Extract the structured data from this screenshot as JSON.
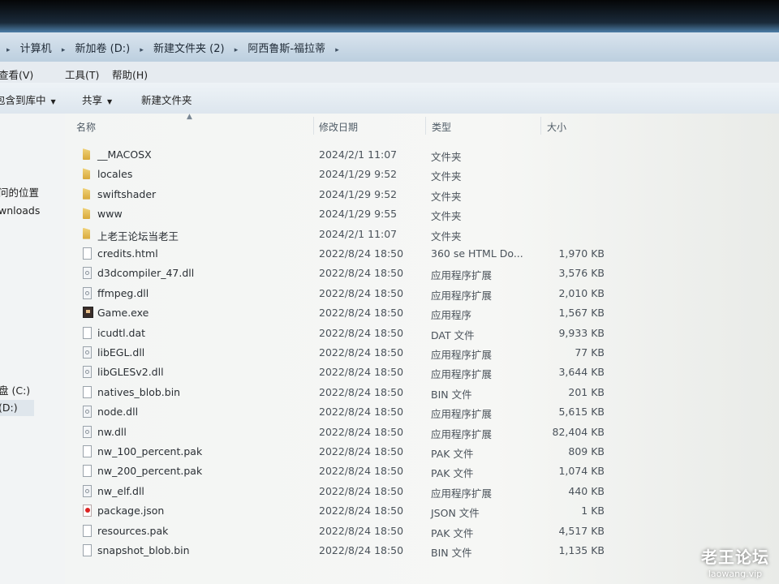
{
  "address": {
    "crumbs": [
      "计算机",
      "新加卷 (D:)",
      "新建文件夹 (2)",
      "阿西鲁斯-福拉蒂"
    ]
  },
  "menubar": {
    "view": "查看(V)",
    "tools": "工具(T)",
    "help": "帮助(H)"
  },
  "toolbar": {
    "include_library": "包含到库中",
    "share": "共享",
    "new_folder": "新建文件夹"
  },
  "nav": {
    "recent_places": "问的位置",
    "downloads": "wnloads",
    "drive_c": "盘 (C:)",
    "drive_d": "(D:)"
  },
  "columns": {
    "name": "名称",
    "date_modified": "修改日期",
    "type": "类型",
    "size": "大小"
  },
  "files": [
    {
      "icon": "folder-icon",
      "name": "__MACOSX",
      "date": "2024/2/1 11:07",
      "type": "文件夹",
      "size": ""
    },
    {
      "icon": "folder-icon",
      "name": "locales",
      "date": "2024/1/29 9:52",
      "type": "文件夹",
      "size": ""
    },
    {
      "icon": "folder-icon",
      "name": "swiftshader",
      "date": "2024/1/29 9:52",
      "type": "文件夹",
      "size": ""
    },
    {
      "icon": "folder-icon",
      "name": "www",
      "date": "2024/1/29 9:55",
      "type": "文件夹",
      "size": ""
    },
    {
      "icon": "folder-icon",
      "name": "上老王论坛当老王",
      "date": "2024/2/1 11:07",
      "type": "文件夹",
      "size": ""
    },
    {
      "icon": "html-file-icon",
      "name": "credits.html",
      "date": "2022/8/24 18:50",
      "type": "360 se HTML Do...",
      "size": "1,970 KB"
    },
    {
      "icon": "dll-file-icon",
      "name": "d3dcompiler_47.dll",
      "date": "2022/8/24 18:50",
      "type": "应用程序扩展",
      "size": "3,576 KB"
    },
    {
      "icon": "dll-file-icon",
      "name": "ffmpeg.dll",
      "date": "2022/8/24 18:50",
      "type": "应用程序扩展",
      "size": "2,010 KB"
    },
    {
      "icon": "exe-file-icon",
      "name": "Game.exe",
      "date": "2022/8/24 18:50",
      "type": "应用程序",
      "size": "1,567 KB"
    },
    {
      "icon": "file-icon",
      "name": "icudtl.dat",
      "date": "2022/8/24 18:50",
      "type": "DAT 文件",
      "size": "9,933 KB"
    },
    {
      "icon": "dll-file-icon",
      "name": "libEGL.dll",
      "date": "2022/8/24 18:50",
      "type": "应用程序扩展",
      "size": "77 KB"
    },
    {
      "icon": "dll-file-icon",
      "name": "libGLESv2.dll",
      "date": "2022/8/24 18:50",
      "type": "应用程序扩展",
      "size": "3,644 KB"
    },
    {
      "icon": "file-icon",
      "name": "natives_blob.bin",
      "date": "2022/8/24 18:50",
      "type": "BIN 文件",
      "size": "201 KB"
    },
    {
      "icon": "dll-file-icon",
      "name": "node.dll",
      "date": "2022/8/24 18:50",
      "type": "应用程序扩展",
      "size": "5,615 KB"
    },
    {
      "icon": "dll-file-icon",
      "name": "nw.dll",
      "date": "2022/8/24 18:50",
      "type": "应用程序扩展",
      "size": "82,404 KB"
    },
    {
      "icon": "file-icon",
      "name": "nw_100_percent.pak",
      "date": "2022/8/24 18:50",
      "type": "PAK 文件",
      "size": "809 KB"
    },
    {
      "icon": "file-icon",
      "name": "nw_200_percent.pak",
      "date": "2022/8/24 18:50",
      "type": "PAK 文件",
      "size": "1,074 KB"
    },
    {
      "icon": "dll-file-icon",
      "name": "nw_elf.dll",
      "date": "2022/8/24 18:50",
      "type": "应用程序扩展",
      "size": "440 KB"
    },
    {
      "icon": "json-file-icon",
      "name": "package.json",
      "date": "2022/8/24 18:50",
      "type": "JSON 文件",
      "size": "1 KB"
    },
    {
      "icon": "file-icon",
      "name": "resources.pak",
      "date": "2022/8/24 18:50",
      "type": "PAK 文件",
      "size": "4,517 KB"
    },
    {
      "icon": "file-icon",
      "name": "snapshot_blob.bin",
      "date": "2022/8/24 18:50",
      "type": "BIN 文件",
      "size": "1,135 KB"
    }
  ],
  "watermark": {
    "main": "老王论坛",
    "sub": "laowang.vip"
  }
}
